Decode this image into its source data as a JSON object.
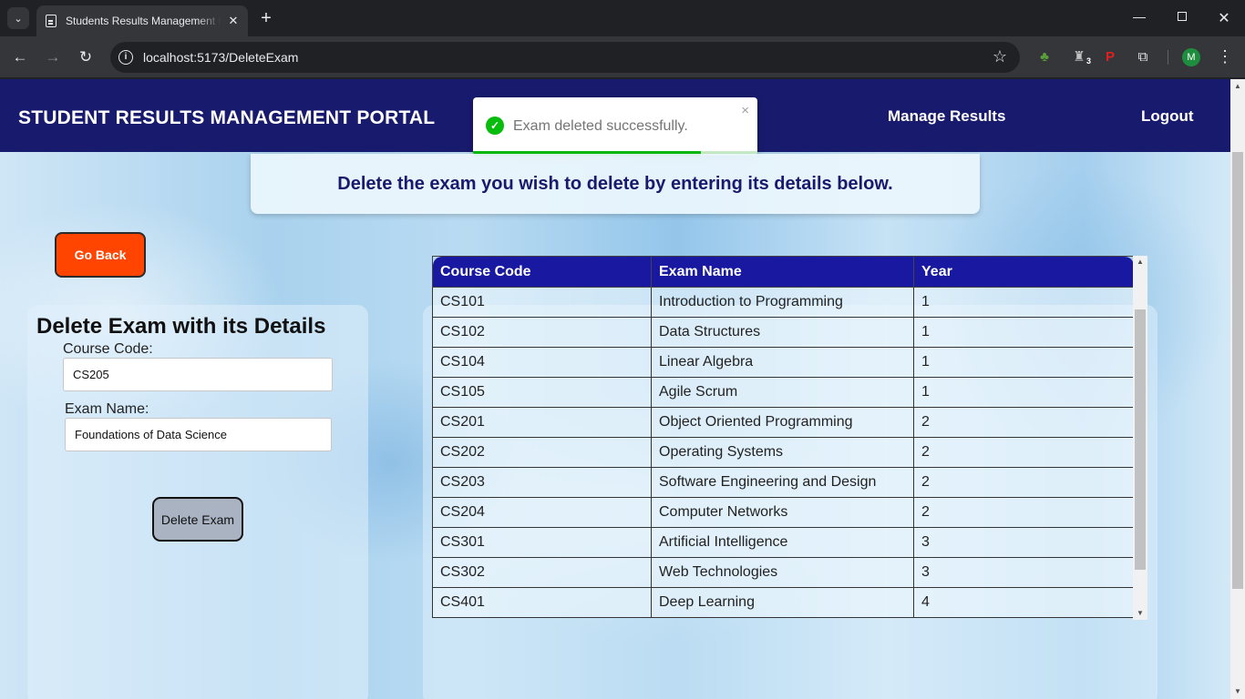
{
  "browser": {
    "tab_title": "Students Results Management Portal",
    "tab_close": "✕",
    "new_tab": "+",
    "url": "localhost:5173/DeleteExam",
    "profile_initial": "M",
    "extension_badge_count": "3"
  },
  "header": {
    "brand": "STUDENT RESULTS MANAGEMENT PORTAL",
    "nav": {
      "manage_results": "Manage Results",
      "logout": "Logout"
    }
  },
  "toast": {
    "message": "Exam deleted successfully.",
    "close": "×",
    "progress_fraction": 0.8
  },
  "banner": {
    "text": "Delete the exam you wish to delete by entering its details below."
  },
  "go_back_label": "Go Back",
  "form": {
    "title": "Delete Exam with its Details",
    "course_code_label": "Course Code:",
    "course_code_value": "CS205",
    "exam_name_label": "Exam Name:",
    "exam_name_value": "Foundations of Data Science",
    "submit_label": "Delete Exam"
  },
  "table": {
    "headers": [
      "Course Code",
      "Exam Name",
      "Year"
    ],
    "rows": [
      [
        "CS101",
        "Introduction to Programming",
        "1"
      ],
      [
        "CS102",
        "Data Structures",
        "1"
      ],
      [
        "CS104",
        "Linear Algebra",
        "1"
      ],
      [
        "CS105",
        "Agile Scrum",
        "1"
      ],
      [
        "CS201",
        "Object Oriented Programming",
        "2"
      ],
      [
        "CS202",
        "Operating Systems",
        "2"
      ],
      [
        "CS203",
        "Software Engineering and Design",
        "2"
      ],
      [
        "CS204",
        "Computer Networks",
        "2"
      ],
      [
        "CS301",
        "Artificial Intelligence",
        "3"
      ],
      [
        "CS302",
        "Web Technologies",
        "3"
      ],
      [
        "CS401",
        "Deep Learning",
        "4"
      ]
    ]
  },
  "colors": {
    "header_bg": "#181a6e",
    "go_back_bg": "#ff4500",
    "table_header_bg": "#1818a0",
    "toast_success": "#07bc0c",
    "delete_btn_bg": "#a9b3c2"
  },
  "icons": {
    "toast": "check-circle-icon",
    "omnibox": "site-info-icon",
    "bookmark": "star-icon"
  }
}
